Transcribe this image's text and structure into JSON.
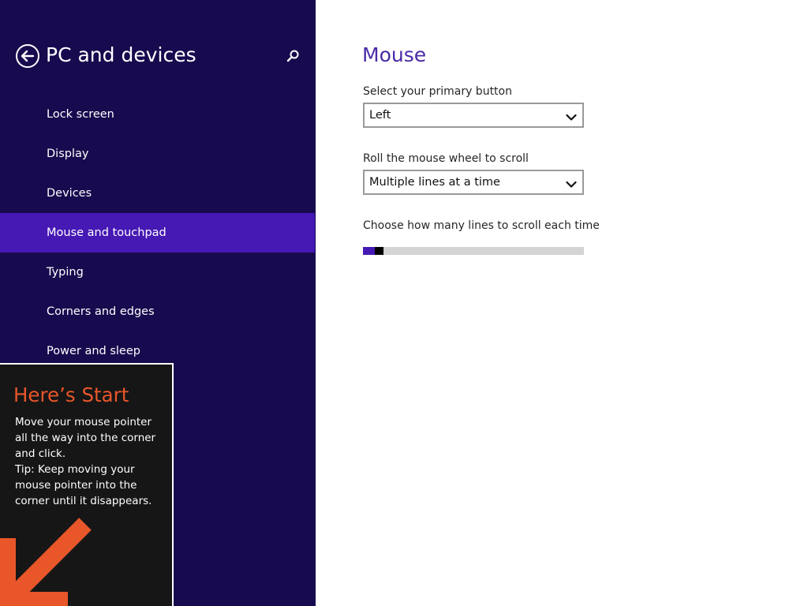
{
  "nav": {
    "title": "PC and devices",
    "back_icon": "back-arrow-icon",
    "search_icon": "search-icon",
    "items": [
      {
        "label": "Lock screen",
        "selected": false
      },
      {
        "label": "Display",
        "selected": false
      },
      {
        "label": "Devices",
        "selected": false
      },
      {
        "label": "Mouse and touchpad",
        "selected": true
      },
      {
        "label": "Typing",
        "selected": false
      },
      {
        "label": "Corners and edges",
        "selected": false
      },
      {
        "label": "Power and sleep",
        "selected": false
      }
    ]
  },
  "tip": {
    "title": "Here’s Start",
    "line1": "Move your mouse pointer all the way into the corner and click.",
    "line2": "Tip: Keep moving your mouse pointer into the corner until it disappears.",
    "arrow_icon": "arrow-down-left-icon"
  },
  "main": {
    "title": "Mouse",
    "primary_button": {
      "label": "Select your primary button",
      "value": "Left"
    },
    "wheel_scroll": {
      "label": "Roll the mouse wheel to scroll",
      "value": "Multiple lines at a time"
    },
    "lines_to_scroll": {
      "label": "Choose how many lines to scroll each time",
      "level": 0.04
    }
  },
  "colors": {
    "nav_background": "#180a4e",
    "nav_selected": "#4618b4",
    "accent_title": "#4b2aa8",
    "tip_title": "#e8562a",
    "tip_arrow": "#e8562a"
  }
}
